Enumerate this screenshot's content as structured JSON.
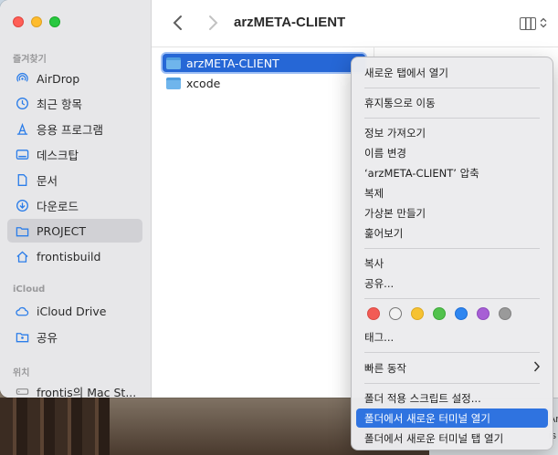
{
  "window": {
    "title": "arzMETA-CLIENT"
  },
  "sidebar": {
    "sections": [
      {
        "label": "즐겨찾기"
      },
      {
        "label": "iCloud"
      },
      {
        "label": "위치"
      }
    ],
    "favorites": [
      {
        "label": "AirDrop",
        "icon": "airdrop-icon"
      },
      {
        "label": "최근 항목",
        "icon": "clock-icon"
      },
      {
        "label": "응용 프로그램",
        "icon": "applications-icon"
      },
      {
        "label": "데스크탑",
        "icon": "desktop-icon"
      },
      {
        "label": "문서",
        "icon": "document-icon"
      },
      {
        "label": "다운로드",
        "icon": "download-icon"
      },
      {
        "label": "PROJECT",
        "icon": "folder-icon",
        "selected": true
      },
      {
        "label": "frontisbuild",
        "icon": "home-icon"
      }
    ],
    "icloud": [
      {
        "label": "iCloud Drive",
        "icon": "cloud-icon"
      },
      {
        "label": "공유",
        "icon": "shared-folder-icon"
      }
    ],
    "locations": [
      {
        "label": "frontis의 Mac St...",
        "icon": "computer-icon"
      }
    ]
  },
  "files": [
    {
      "name": "arzMETA-CLIENT",
      "selected": true
    },
    {
      "name": "xcode",
      "selected": false
    }
  ],
  "context_menu": {
    "items": {
      "open_new_tab": "새로운 탭에서 열기",
      "move_to_trash": "휴지통으로 이동",
      "get_info": "정보 가져오기",
      "rename": "이름 변경",
      "compress": "‘arzMETA-CLIENT’ 압축",
      "duplicate": "복제",
      "make_alias": "가상본 만들기",
      "quick_look": "훑어보기",
      "copy": "복사",
      "share": "공유...",
      "tags": "태그...",
      "quick_actions": "빠른 동작",
      "folder_actions_setup": "폴더 적용 스크립트 설정...",
      "new_terminal_at_folder": "폴더에서 새로운 터미널 열기",
      "new_terminal_tab_at_folder": "폴더에서 새로운 터미널 탭 열기"
    },
    "highlighted": "new_terminal_at_folder",
    "tag_colors": [
      "#f25b55",
      "#f2f2f2",
      "#f6c232",
      "#52c24d",
      "#2f86f0",
      "#a75fd5",
      "#9a9a9a"
    ]
  },
  "desktop_fragments": {
    "partial_text_1": "Ar",
    "partial_text_2": "is"
  }
}
